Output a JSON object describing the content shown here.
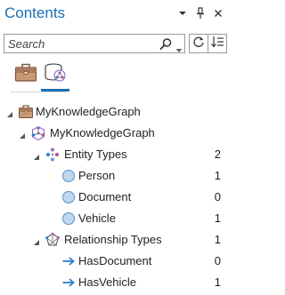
{
  "pane": {
    "title": "Contents",
    "header_icons": [
      "chevron-down-icon",
      "pin-icon",
      "close-icon"
    ]
  },
  "search": {
    "placeholder": "Search",
    "value": ""
  },
  "tabs": [
    {
      "name": "list-by-data-source",
      "icon": "briefcase-icon",
      "selected": false
    },
    {
      "name": "list-by-knowledge-graph",
      "icon": "knowledge-graph-db-icon",
      "selected": true
    }
  ],
  "tree": {
    "root": {
      "label": "MyKnowledgeGraph",
      "icon": "briefcase-icon"
    },
    "graph": {
      "label": "MyKnowledgeGraph",
      "icon": "knowledge-graph-icon"
    },
    "entity_types": {
      "label": "Entity Types",
      "count": "2",
      "items": [
        {
          "label": "Person",
          "count": "1"
        },
        {
          "label": "Document",
          "count": "0"
        },
        {
          "label": "Vehicle",
          "count": "1"
        }
      ]
    },
    "relationship_types": {
      "label": "Relationship Types",
      "count": "1",
      "items": [
        {
          "label": "HasDocument",
          "count": "0"
        },
        {
          "label": "HasVehicle",
          "count": "1"
        }
      ]
    }
  },
  "colors": {
    "accent": "#1a6fb5",
    "entity_circle": "#bcd8f0",
    "entity_circle_stroke": "#5a8fc2",
    "briefcase": "#a8795a",
    "arrow": "#2a7fd0"
  }
}
